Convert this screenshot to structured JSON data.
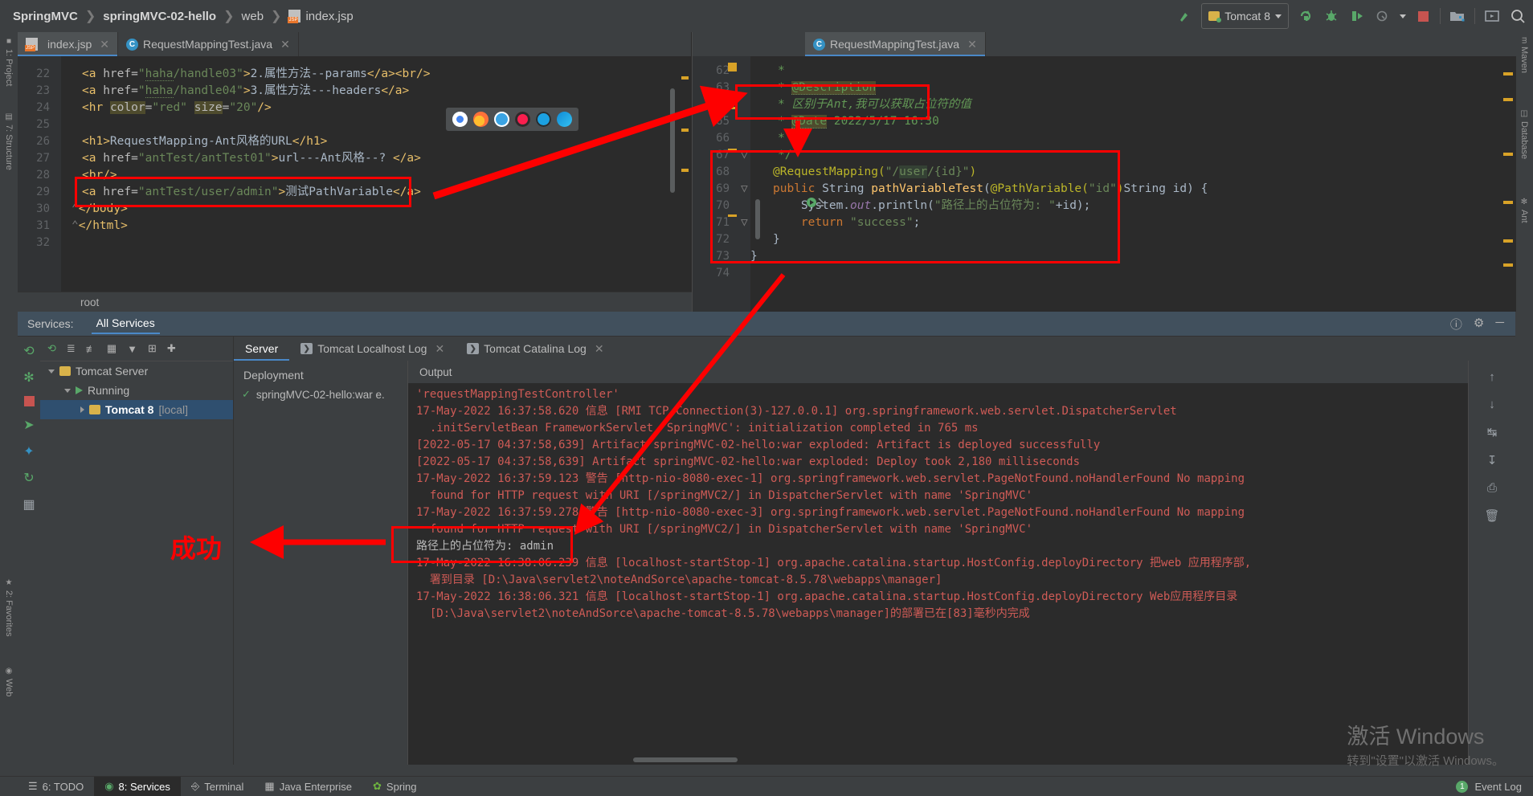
{
  "breadcrumb": {
    "items": [
      "SpringMVC",
      "springMVC-02-hello",
      "web",
      "index.jsp"
    ]
  },
  "toolbar": {
    "run_config": "Tomcat 8",
    "icons": [
      "build-icon",
      "rerun-icon",
      "debug-icon",
      "run-with-coverage-icon",
      "profiler-icon",
      "stop-icon",
      "project-structure-icon",
      "console-icon",
      "search-icon"
    ]
  },
  "left_tool_strip": {
    "items": [
      "1: Project",
      "7: Structure",
      "2: Favorites",
      "Web"
    ]
  },
  "right_tool_strip": {
    "items": [
      "Maven",
      "Database",
      "Ant"
    ]
  },
  "editor_left": {
    "tabs": [
      {
        "label": "index.jsp",
        "icon": "jsp-file-icon",
        "active": true
      },
      {
        "label": "RequestMappingTest.java",
        "icon": "java-class-icon",
        "active": false
      }
    ],
    "breadcrumb_bottom": "root",
    "lines": [
      {
        "num": "22",
        "text": "<a href=\"haha/handle03\">2.属性方法--params</a><br/>"
      },
      {
        "num": "23",
        "text": "<a href=\"haha/handle04\">3.属性方法---headers</a>"
      },
      {
        "num": "24",
        "text": "<hr color=\"red\" size=\"20\"/>"
      },
      {
        "num": "25",
        "text": ""
      },
      {
        "num": "26",
        "text": "<h1>RequestMapping-Ant风格的URL</h1>"
      },
      {
        "num": "27",
        "text": "<a href=\"antTest/antTest01\">url---Ant风格--? </a>"
      },
      {
        "num": "28",
        "text": "<br/>"
      },
      {
        "num": "29",
        "text": "<a href=\"antTest/user/admin\">测试PathVariable</a>"
      },
      {
        "num": "30",
        "text": "</body>"
      },
      {
        "num": "31",
        "text": "</html>"
      },
      {
        "num": "32",
        "text": ""
      }
    ]
  },
  "editor_right": {
    "tabs": [
      {
        "label": "RequestMappingTest.java",
        "icon": "java-class-icon",
        "active": true
      }
    ],
    "lines": [
      {
        "num": "62",
        "text": " *"
      },
      {
        "num": "63",
        "text": " * @Description"
      },
      {
        "num": "64",
        "text": " * 区别于Ant,我可以获取占位符的值"
      },
      {
        "num": "65",
        "text": " * @Date 2022/5/17 16:30"
      },
      {
        "num": "66",
        "text": " *"
      },
      {
        "num": "67",
        "text": " */"
      },
      {
        "num": "68",
        "text": "@RequestMapping(\"/user/{id}\")"
      },
      {
        "num": "69",
        "text": "public String pathVariableTest(@PathVariable(\"id\")String id) {"
      },
      {
        "num": "70",
        "text": "    System.out.println(\"路径上的占位符为: \"+id);"
      },
      {
        "num": "71",
        "text": "    return \"success\";"
      },
      {
        "num": "72",
        "text": "}"
      },
      {
        "num": "73",
        "text": "}"
      },
      {
        "num": "74",
        "text": ""
      }
    ]
  },
  "services": {
    "label": "Services:",
    "tab": "All Services",
    "tree_toolbar_icons": [
      "rerun-icon",
      "expand-all-icon",
      "collapse-all-icon",
      "group-icon",
      "filter-icon",
      "add-tab-icon",
      "add-icon"
    ],
    "tree": [
      {
        "label": "Tomcat Server",
        "icon": "tomcat-icon",
        "level": 0,
        "expanded": true,
        "selected": false
      },
      {
        "label": "Running",
        "icon": "running-icon",
        "level": 1,
        "expanded": true,
        "selected": false
      },
      {
        "label": "Tomcat 8",
        "suffix": "[local]",
        "icon": "tomcat-icon",
        "level": 2,
        "expanded": false,
        "selected": true
      }
    ],
    "log_tabs": [
      {
        "label": "Server",
        "active": true
      },
      {
        "label": "Tomcat Localhost Log",
        "active": false
      },
      {
        "label": "Tomcat Catalina Log",
        "active": false
      }
    ],
    "deployment": {
      "header": "Deployment",
      "artifact": "springMVC-02-hello:war e."
    },
    "output_header": "Output",
    "console_lines": [
      "'requestMappingTestController'",
      "17-May-2022 16:37:58.620 信息 [RMI TCP Connection(3)-127.0.0.1] org.springframework.web.servlet.DispatcherServlet",
      "  .initServletBean FrameworkServlet 'SpringMVC': initialization completed in 765 ms",
      "[2022-05-17 04:37:58,639] Artifact springMVC-02-hello:war exploded: Artifact is deployed successfully",
      "[2022-05-17 04:37:58,639] Artifact springMVC-02-hello:war exploded: Deploy took 2,180 milliseconds",
      "17-May-2022 16:37:59.123 警告 [http-nio-8080-exec-1] org.springframework.web.servlet.PageNotFound.noHandlerFound No mapping",
      "  found for HTTP request with URI [/springMVC2/] in DispatcherServlet with name 'SpringMVC'",
      "17-May-2022 16:37:59.278 警告 [http-nio-8080-exec-3] org.springframework.web.servlet.PageNotFound.noHandlerFound No mapping",
      "  found for HTTP request with URI [/springMVC2/] in DispatcherServlet with name 'SpringMVC'",
      "路径上的占位符为: admin",
      "17-May-2022 16:38:06.239 信息 [localhost-startStop-1] org.apache.catalina.startup.HostConfig.deployDirectory 把web 应用程序部,",
      "  署到目录 [D:\\Java\\servlet2\\noteAndSorce\\apache-tomcat-8.5.78\\webapps\\manager]",
      "17-May-2022 16:38:06.321 信息 [localhost-startStop-1] org.apache.catalina.startup.HostConfig.deployDirectory Web应用程序目录",
      "  [D:\\Java\\servlet2\\noteAndSorce\\apache-tomcat-8.5.78\\webapps\\manager]的部署已在[83]毫秒内完成"
    ],
    "console_side_icons": [
      "scroll-up-icon",
      "scroll-down-icon",
      "soft-wrap-icon",
      "scroll-to-end-icon",
      "print-icon",
      "clear-all-icon"
    ]
  },
  "statusbar": {
    "items": [
      {
        "label": "6: TODO",
        "icon": "todo-icon",
        "active": false
      },
      {
        "label": "8: Services",
        "icon": "services-icon",
        "active": true
      },
      {
        "label": "Terminal",
        "icon": "terminal-icon",
        "active": false
      },
      {
        "label": "Java Enterprise",
        "icon": "java-enterprise-icon",
        "active": false
      },
      {
        "label": "Spring",
        "icon": "spring-icon",
        "active": false
      }
    ],
    "event_log": "Event Log",
    "event_count": "1"
  },
  "watermark": {
    "line1": "激活 Windows",
    "line2": "转到\"设置\"以激活 Windows。"
  },
  "annotations": {
    "note_comment": "区别于Ant,我可以获取占位符的值",
    "success_text": "成功",
    "console_highlight": "路径上的占位符为: admin",
    "accent_red": "#fe0000"
  }
}
